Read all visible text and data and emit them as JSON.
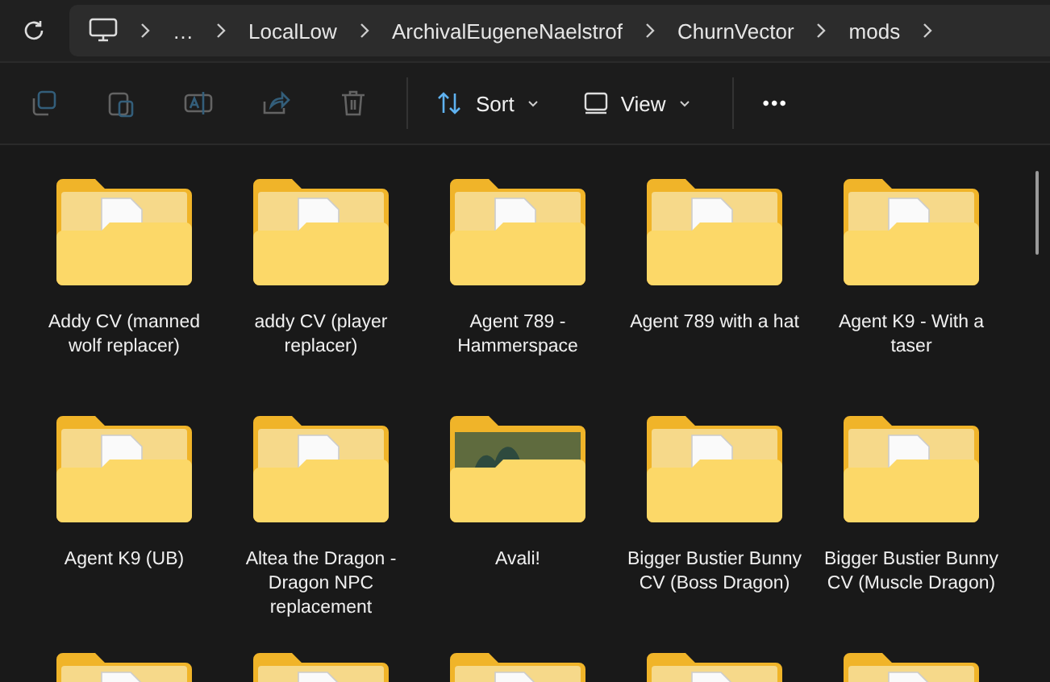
{
  "address_bar": {
    "crumbs": [
      "…",
      "LocalLow",
      "ArchivalEugeneNaelstrof",
      "ChurnVector",
      "mods"
    ]
  },
  "toolbar": {
    "actions": [
      {
        "kind": "copy",
        "disabled": true
      },
      {
        "kind": "paste",
        "disabled": true
      },
      {
        "kind": "rename",
        "disabled": true
      },
      {
        "kind": "share",
        "disabled": true
      },
      {
        "kind": "delete",
        "disabled": true
      }
    ],
    "sort": {
      "label": "Sort"
    },
    "view": {
      "label": "View"
    },
    "more": {
      "label": "•••"
    }
  },
  "items": [
    {
      "kind": "folder",
      "label": "Addy CV (manned wolf replacer)"
    },
    {
      "kind": "folder",
      "label": "addy CV (player replacer)"
    },
    {
      "kind": "folder",
      "label": "Agent 789 - Hammerspace"
    },
    {
      "kind": "folder",
      "label": "Agent 789 with a hat"
    },
    {
      "kind": "folder",
      "label": "Agent K9 - With a taser"
    },
    {
      "kind": "folder",
      "label": "Agent K9 (UB)"
    },
    {
      "kind": "folder",
      "label": "Altea the Dragon - Dragon NPC replacement"
    },
    {
      "kind": "thumbnail",
      "label": "Avali!"
    },
    {
      "kind": "folder",
      "label": "Bigger Bustier Bunny CV (Boss Dragon)"
    },
    {
      "kind": "folder",
      "label": "Bigger Bustier Bunny CV (Muscle Dragon)"
    },
    {
      "kind": "folder"
    },
    {
      "kind": "folder"
    },
    {
      "kind": "folder"
    },
    {
      "kind": "folder"
    },
    {
      "kind": "folder"
    }
  ]
}
